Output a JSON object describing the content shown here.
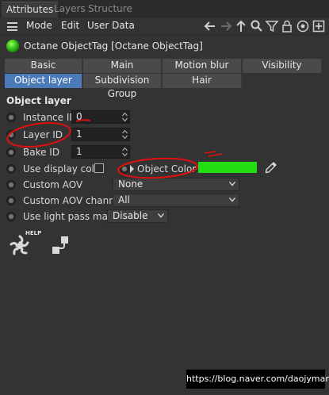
{
  "panel_tabs": [
    "Attributes",
    "Layers",
    "Structure"
  ],
  "menu": [
    "Mode",
    "Edit",
    "User Data"
  ],
  "toolbar_icons": [
    "arrow-left-icon",
    "arrow-right-icon",
    "arrow-up-icon",
    "search-icon",
    "filter-icon",
    "lock-icon",
    "target-icon",
    "add-icon"
  ],
  "object_title": "Octane ObjectTag [Octane ObjectTag]",
  "section_tabs_row1": [
    "Basic",
    "Main",
    "Motion blur",
    "Visibility"
  ],
  "section_tabs_row2": [
    "Object layer",
    "Subdivision Group",
    "Hair"
  ],
  "selected_section_tab": "Object layer",
  "section_title": "Object layer",
  "fields": {
    "instance_id": {
      "label": "Instance ID",
      "value": "0"
    },
    "layer_id": {
      "label": "Layer ID",
      "value": "1"
    },
    "bake_id": {
      "label": "Bake ID",
      "value": "1"
    },
    "use_display_color": {
      "label": "Use display color",
      "checked": false
    },
    "object_color": {
      "label": "Object Color",
      "color": "#22dd11"
    },
    "custom_aov": {
      "label": "Custom AOV",
      "value": "None"
    },
    "custom_aov_channel": {
      "label": "Custom AOV channel",
      "value": "All"
    },
    "use_light_pass_mask": {
      "label": "Use light pass mark",
      "value": "Disable"
    }
  },
  "help_label": "HELP",
  "watermark": "https://blog.naver.com/daojyman",
  "colors": {
    "accent": "#4a7ab8",
    "annotation": "#e01010",
    "swatch": "#22dd11"
  }
}
